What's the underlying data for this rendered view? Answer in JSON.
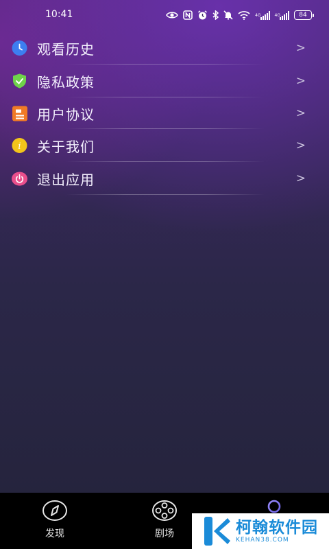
{
  "status_bar": {
    "time": "10:41",
    "network_1": "4G",
    "network_2": "4G",
    "battery": "84",
    "icons": [
      "eye-icon",
      "nfc-icon",
      "alarm-icon",
      "bluetooth-icon",
      "mute-icon",
      "wifi-icon",
      "signal-icon",
      "signal-icon",
      "battery-icon"
    ]
  },
  "menu": {
    "items": [
      {
        "label": "观看历史",
        "icon": "clock-icon",
        "icon_color": "#3d7ef0",
        "chevron": ">"
      },
      {
        "label": "隐私政策",
        "icon": "shield-check-icon",
        "icon_color": "#6fd24a",
        "chevron": ">"
      },
      {
        "label": "用户协议",
        "icon": "document-icon",
        "icon_color": "#f07a26",
        "chevron": ">"
      },
      {
        "label": "关于我们",
        "icon": "info-icon",
        "icon_color": "#f3c51b",
        "chevron": ">"
      },
      {
        "label": "退出应用",
        "icon": "power-icon",
        "icon_color": "#ea4f8c",
        "chevron": ">"
      }
    ]
  },
  "tabbar": {
    "tabs": [
      {
        "label": "发现",
        "icon": "compass-icon"
      },
      {
        "label": "剧场",
        "icon": "film-reel-icon"
      },
      {
        "label": "",
        "icon": "user-icon",
        "active_color": "#8a7cf5"
      }
    ]
  },
  "watermark": {
    "title": "柯翰软件园",
    "subtitle": "KEHAN38.COM",
    "color": "#1a8bd8"
  }
}
